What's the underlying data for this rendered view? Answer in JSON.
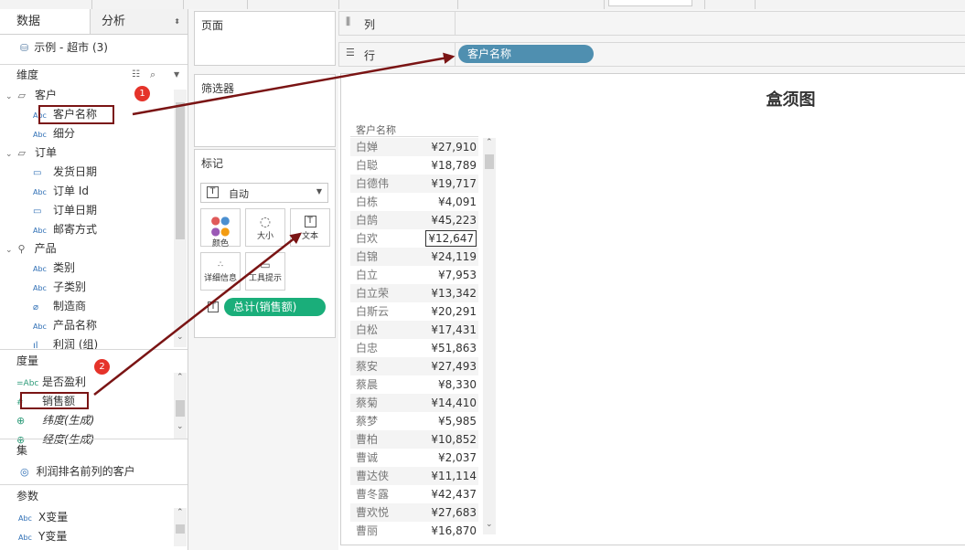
{
  "left_tabs": {
    "data": "数据",
    "analysis": "分析"
  },
  "datasource": "示例 - 超市 (3)",
  "dimensions": {
    "header": "维度",
    "items": [
      {
        "tag": "",
        "label": "客户",
        "kind": "folder"
      },
      {
        "tag": "Abc",
        "label": "客户名称",
        "kind": "field"
      },
      {
        "tag": "Abc",
        "label": "细分",
        "kind": "field"
      },
      {
        "tag": "",
        "label": "订单",
        "kind": "folder"
      },
      {
        "tag": "cal",
        "label": "发货日期",
        "kind": "field"
      },
      {
        "tag": "Abc",
        "label": "订单 Id",
        "kind": "field"
      },
      {
        "tag": "cal",
        "label": "订单日期",
        "kind": "field"
      },
      {
        "tag": "Abc",
        "label": "邮寄方式",
        "kind": "field"
      },
      {
        "tag": "",
        "label": "产品",
        "kind": "hier"
      },
      {
        "tag": "Abc",
        "label": "类别",
        "kind": "field"
      },
      {
        "tag": "Abc",
        "label": "子类别",
        "kind": "field"
      },
      {
        "tag": "clip",
        "label": "制造商",
        "kind": "field"
      },
      {
        "tag": "Abc",
        "label": "产品名称",
        "kind": "field"
      },
      {
        "tag": "bar",
        "label": "利润 (组)",
        "kind": "field"
      }
    ]
  },
  "measures": {
    "header": "度量",
    "items": [
      {
        "tag": "=Abc",
        "label": "是否盈利"
      },
      {
        "tag": "#",
        "label": "销售额"
      },
      {
        "tag": "globe",
        "label": "纬度(生成)"
      },
      {
        "tag": "globe",
        "label": "经度(生成)"
      }
    ]
  },
  "sets": {
    "header": "集",
    "items": [
      {
        "label": "利润排名前列的客户"
      }
    ]
  },
  "params": {
    "header": "参数",
    "items": [
      {
        "tag": "Abc",
        "label": "X变量"
      },
      {
        "tag": "Abc",
        "label": "Y变量"
      }
    ]
  },
  "cards": {
    "pages": "页面",
    "filters": "筛选器",
    "marks": "标记"
  },
  "marks": {
    "type": "自动",
    "buttons": [
      "颜色",
      "大小",
      "文本",
      "详细信息",
      "工具提示"
    ],
    "pill": "总计(销售额)"
  },
  "shelves": {
    "columns": "列",
    "rows": "行",
    "rows_pill": "客户名称"
  },
  "view": {
    "title": "盒须图",
    "column_header": "客户名称",
    "rows": [
      {
        "name": "白婵",
        "value": "¥27,910"
      },
      {
        "name": "白聪",
        "value": "¥18,789"
      },
      {
        "name": "白德伟",
        "value": "¥19,717"
      },
      {
        "name": "白栋",
        "value": "¥4,091"
      },
      {
        "name": "白鹄",
        "value": "¥45,223"
      },
      {
        "name": "白欢",
        "value": "¥12,647"
      },
      {
        "name": "白锦",
        "value": "¥24,119"
      },
      {
        "name": "白立",
        "value": "¥7,953"
      },
      {
        "name": "白立荣",
        "value": "¥13,342"
      },
      {
        "name": "白斯云",
        "value": "¥20,291"
      },
      {
        "name": "白松",
        "value": "¥17,431"
      },
      {
        "name": "白忠",
        "value": "¥51,863"
      },
      {
        "name": "蔡安",
        "value": "¥27,493"
      },
      {
        "name": "蔡晨",
        "value": "¥8,330"
      },
      {
        "name": "蔡菊",
        "value": "¥14,410"
      },
      {
        "name": "蔡梦",
        "value": "¥5,985"
      },
      {
        "name": "曹柏",
        "value": "¥10,852"
      },
      {
        "name": "曹诚",
        "value": "¥2,037"
      },
      {
        "name": "曹达侠",
        "value": "¥11,114"
      },
      {
        "name": "曹冬露",
        "value": "¥42,437"
      },
      {
        "name": "曹欢悦",
        "value": "¥27,683"
      },
      {
        "name": "曹丽",
        "value": "¥16,870"
      }
    ]
  },
  "annotations": {
    "badge1": "1",
    "badge2": "2"
  },
  "colors": {
    "rows_pill": "#4f8fb0",
    "marks_pill": "#1aae7a",
    "arrow": "#7a1414",
    "badge": "#e5332a"
  }
}
